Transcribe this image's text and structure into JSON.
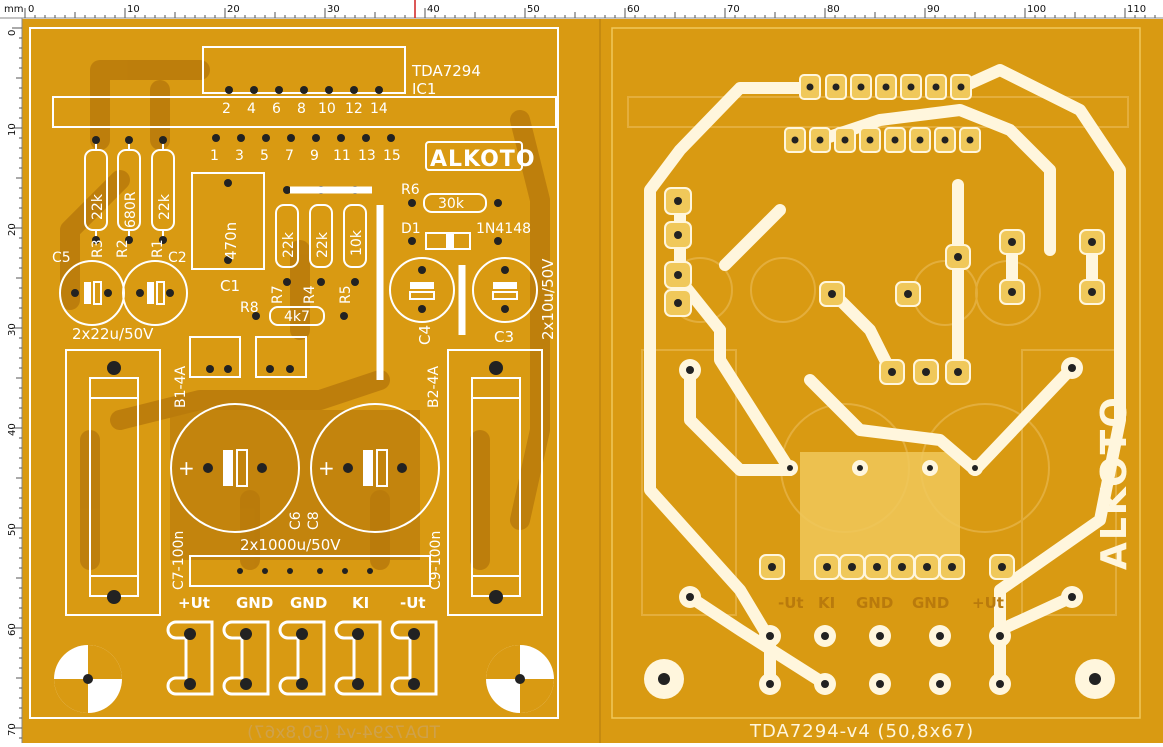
{
  "ruler": {
    "unit": "mm",
    "x_ticks": [
      "0",
      "10",
      "20",
      "30",
      "40",
      "50",
      "60",
      "70",
      "80",
      "90",
      "100",
      "110"
    ],
    "y_ticks": [
      "0",
      "10",
      "20",
      "30",
      "40",
      "50",
      "60",
      "70"
    ]
  },
  "colors": {
    "board": "#d99a12",
    "board_dark": "#b97a0c",
    "copper_mirror": "#f0c85a",
    "trace_white": "#fff6dd",
    "silk": "#ffffff"
  },
  "left_board": {
    "ic_label": "TDA7294",
    "ic_ref": "IC1",
    "pins_top": [
      "2",
      "4",
      "6",
      "8",
      "10",
      "12",
      "14"
    ],
    "pins_bottom": [
      "1",
      "3",
      "5",
      "7",
      "9",
      "11",
      "13",
      "15"
    ],
    "logo": "ALKOTO",
    "r3": "R3",
    "r3_val": "22k",
    "r2": "R2",
    "r2_val": "680R",
    "r1": "R1",
    "r1_val": "22k",
    "c1": "C1",
    "c1_val": "470n",
    "r7": "R7",
    "r7_val": "22k",
    "r4": "R4",
    "r4_val": "22k",
    "r5": "R5",
    "r5_val": "10k",
    "r6": "R6",
    "r6_val": "30k",
    "d1": "D1",
    "d1_val": "1N4148",
    "c5": "C5",
    "c2": "C2",
    "c5c2_val": "2x22u/50V",
    "r8": "R8",
    "r8_val": "4k7",
    "c4": "C4",
    "c3": "C3",
    "c4c3_val": "2x10u/50V",
    "b1": "B1-4A",
    "b2": "B2-4A",
    "c6": "C6",
    "c8": "C8",
    "big_caps": "2x1000u/50V",
    "c7": "C7-100n",
    "c9": "C9-100n",
    "terminals": [
      "+Ut",
      "GND",
      "GND",
      "KI",
      "-Ut"
    ],
    "footer": "TDA7294-v4 (50,8x67)"
  },
  "right_board": {
    "footer": "TDA7294-v4 (50,8x67)",
    "logo": "ALKOTO",
    "terminals": [
      "-Ut",
      "KI",
      "GND",
      "GND",
      "+Ut"
    ]
  }
}
